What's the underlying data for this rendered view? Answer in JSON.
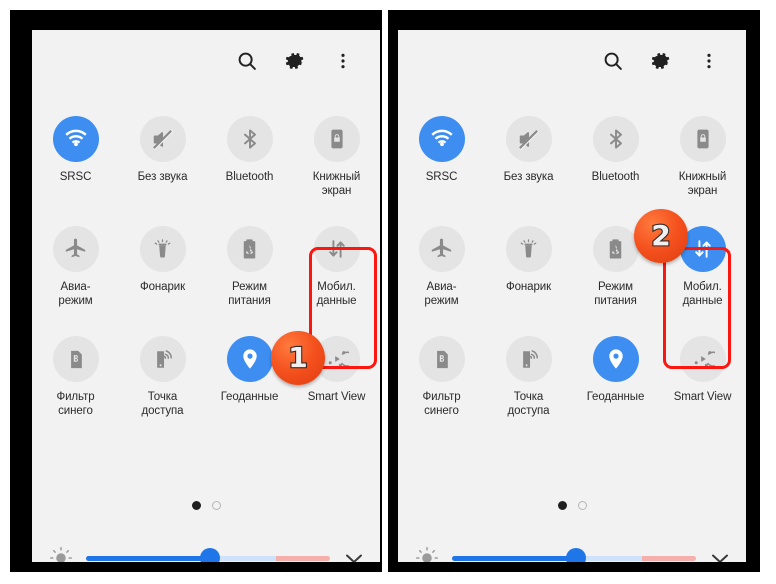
{
  "theme": {
    "accent_blue": "#3d8ef0",
    "slider_blue": "#1f76e8",
    "highlight_red": "#fb1710",
    "badge_orange": "#f4511e",
    "panel_bg": "#f2f2f2",
    "tile_off_bg": "#e4e4e4"
  },
  "topbar": {
    "search_label": "search-icon",
    "settings_label": "gear-icon",
    "more_label": "overflow-menu-icon"
  },
  "panels": [
    {
      "id": "before",
      "badge": "1",
      "tiles": [
        {
          "label": "SRSC",
          "icon": "wifi",
          "on": true
        },
        {
          "label": "Без звука",
          "icon": "mute",
          "on": false
        },
        {
          "label": "Bluetooth",
          "icon": "bluetooth",
          "on": false
        },
        {
          "label": "Книжный\nэкран",
          "icon": "rotation-lock",
          "on": false
        },
        {
          "label": "Авиа-\nрежим",
          "icon": "airplane",
          "on": false
        },
        {
          "label": "Фонарик",
          "icon": "flashlight",
          "on": false
        },
        {
          "label": "Режим\nпитания",
          "icon": "power-saving",
          "on": false
        },
        {
          "label": "Мобил.\nданные",
          "icon": "mobile-data",
          "on": false
        },
        {
          "label": "Фильтр\nсинего",
          "icon": "blue-filter",
          "on": false
        },
        {
          "label": "Точка\nдоступа",
          "icon": "hotspot",
          "on": false
        },
        {
          "label": "Геоданные",
          "icon": "location",
          "on": true
        },
        {
          "label": "Smart View",
          "icon": "smart-view",
          "on": false
        }
      ],
      "pages": {
        "count": 2,
        "active": 1
      },
      "brightness": {
        "value": 51,
        "min": 0,
        "max": 100
      }
    },
    {
      "id": "after",
      "badge": "2",
      "tiles": [
        {
          "label": "SRSC",
          "icon": "wifi",
          "on": true
        },
        {
          "label": "Без звука",
          "icon": "mute",
          "on": false
        },
        {
          "label": "Bluetooth",
          "icon": "bluetooth",
          "on": false
        },
        {
          "label": "Книжный\nэкран",
          "icon": "rotation-lock",
          "on": false
        },
        {
          "label": "Авиа-\nрежим",
          "icon": "airplane",
          "on": false
        },
        {
          "label": "Фонарик",
          "icon": "flashlight",
          "on": false
        },
        {
          "label": "Режим\nпитания",
          "icon": "power-saving",
          "on": false
        },
        {
          "label": "Мобил.\nданные",
          "icon": "mobile-data",
          "on": true
        },
        {
          "label": "Фильтр\nсинего",
          "icon": "blue-filter",
          "on": false
        },
        {
          "label": "Точка\nдоступа",
          "icon": "hotspot",
          "on": false
        },
        {
          "label": "Геоданные",
          "icon": "location",
          "on": true
        },
        {
          "label": "Smart View",
          "icon": "smart-view",
          "on": false
        }
      ],
      "pages": {
        "count": 2,
        "active": 1
      },
      "brightness": {
        "value": 51,
        "min": 0,
        "max": 100
      }
    }
  ]
}
